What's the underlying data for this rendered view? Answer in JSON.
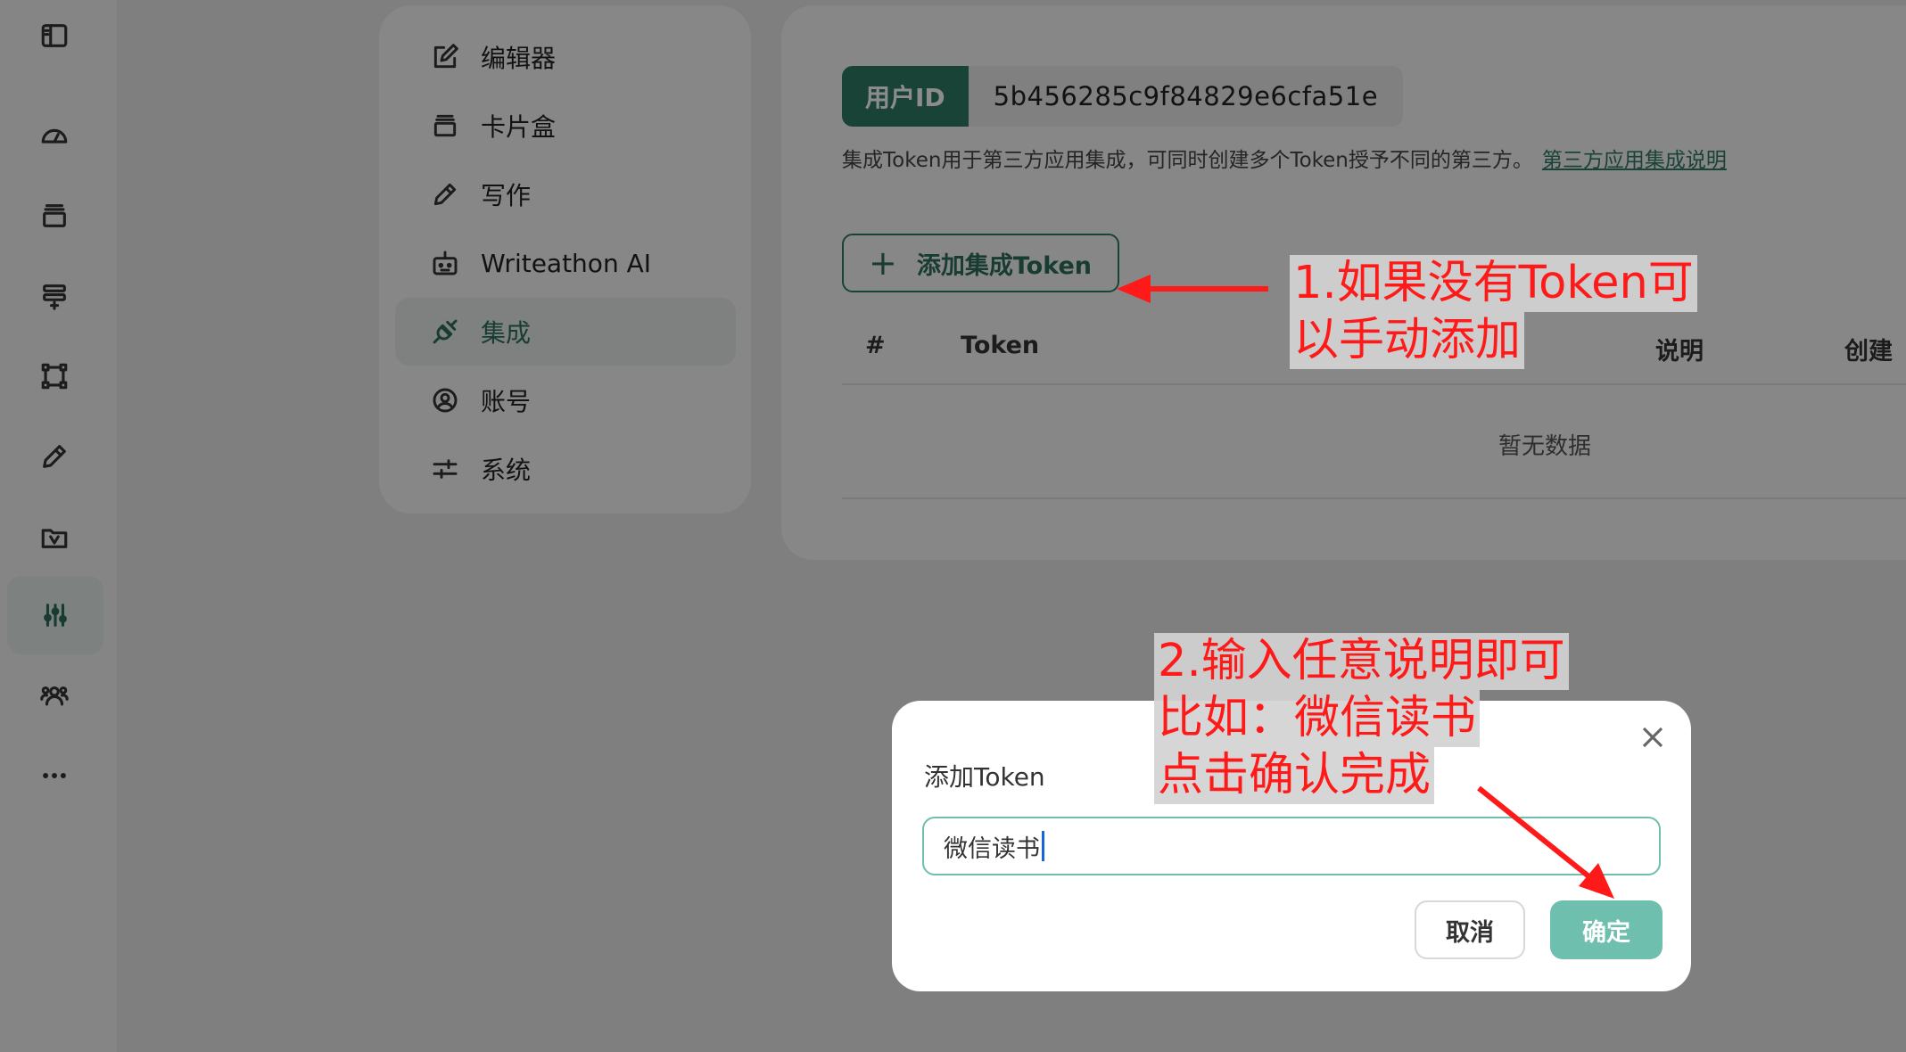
{
  "rail": {
    "icons": [
      "sidebar-toggle-icon",
      "dashboard-icon",
      "card-box-icon",
      "template-icon",
      "nodes-icon",
      "pencil-icon",
      "folder-v-icon",
      "sliders-icon",
      "users-icon",
      "more-icon"
    ],
    "active_index": 7
  },
  "settings_menu": {
    "items": [
      {
        "label": "编辑器",
        "icon": "edit-icon"
      },
      {
        "label": "卡片盒",
        "icon": "card-box-icon"
      },
      {
        "label": "写作",
        "icon": "pencil-icon"
      },
      {
        "label": "Writeathon AI",
        "icon": "robot-icon"
      },
      {
        "label": "集成",
        "icon": "plug-icon",
        "active": true
      },
      {
        "label": "账号",
        "icon": "user-circle-icon"
      },
      {
        "label": "系统",
        "icon": "sliders-icon"
      }
    ]
  },
  "integration": {
    "user_id_tag": "用户ID",
    "user_id_value": "5b456285c9f84829e6cfa51e",
    "description": "集成Token用于第三方应用集成，可同时创建多个Token授予不同的第三方。",
    "description_link": "第三方应用集成说明",
    "add_token_label": "添加集成Token",
    "table_headers": [
      "#",
      "Token",
      "说明",
      "创建"
    ],
    "empty_text": "暂无数据"
  },
  "modal": {
    "title": "添加Token",
    "input_value": "微信读书",
    "cancel_label": "取消",
    "ok_label": "确定"
  },
  "annotations": {
    "note1_line1": "1.如果没有Token可",
    "note1_line2": "以手动添加",
    "note2_line1": "2.输入任意说明即可",
    "note2_line2": "比如：微信读书",
    "note2_line3": "点击确认完成",
    "color": "#ff1a1a"
  },
  "colors": {
    "accent": "#2f7a65",
    "accent_light": "#6ebfad"
  }
}
